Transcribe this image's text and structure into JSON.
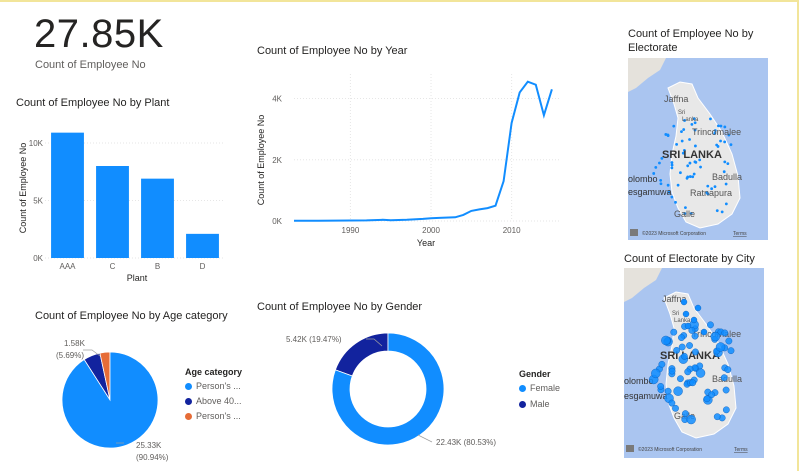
{
  "kpi": {
    "value": "27.85K",
    "label": "Count of Employee No"
  },
  "colors": {
    "primary": "#118dff",
    "dark_blue": "#12239e",
    "orange": "#e66c37",
    "map_water": "#aac5f0",
    "map_land": "#e8e8e8"
  },
  "chart_data": [
    {
      "type": "bar",
      "title": "Count of Employee No by Plant",
      "xlabel": "Plant",
      "ylabel": "Count of Employee No",
      "categories": [
        "AAA",
        "C",
        "B",
        "D"
      ],
      "values": [
        10900,
        8000,
        6900,
        2100
      ],
      "ylim": [
        0,
        12000
      ],
      "yticks": [
        0,
        5000,
        10000
      ],
      "ytick_labels": [
        "0K",
        "5K",
        "10K"
      ],
      "grid": true
    },
    {
      "type": "line",
      "title": "Count of Employee No by Year",
      "xlabel": "Year",
      "ylabel": "Count of Employee No",
      "x": [
        1983,
        1986,
        1990,
        1992,
        1994,
        1995,
        1997,
        1999,
        2000,
        2001,
        2003,
        2004,
        2005,
        2006,
        2007,
        2008,
        2009,
        2010,
        2011,
        2012,
        2013,
        2014,
        2015
      ],
      "y": [
        10,
        10,
        15,
        20,
        40,
        25,
        40,
        70,
        90,
        100,
        120,
        200,
        330,
        380,
        420,
        500,
        1300,
        3200,
        4200,
        4550,
        4450,
        3450,
        4300
      ],
      "xlim": [
        1983,
        2016
      ],
      "ylim": [
        0,
        4800
      ],
      "xticks": [
        1990,
        2000,
        2010
      ],
      "yticks": [
        0,
        2000,
        4000
      ],
      "ytick_labels": [
        "0K",
        "2K",
        "4K"
      ],
      "grid": true
    },
    {
      "type": "pie",
      "title": "Count of Employee No by Age category",
      "legend_title": "Age category",
      "legend_position": "right",
      "slices": [
        {
          "name": "Person's ...",
          "value": 25330,
          "label": "25.33K",
          "pct_label": "(90.94%)",
          "color": "#118dff"
        },
        {
          "name": "Above 40...",
          "value": 1580,
          "label": "1.58K",
          "pct_label": "(5.69%)",
          "color": "#12239e"
        },
        {
          "name": "Person's ...",
          "value": 940,
          "label": "",
          "pct_label": "",
          "color": "#e66c37"
        }
      ]
    },
    {
      "type": "pie",
      "title": "Count of Employee No by Gender",
      "legend_title": "Gender",
      "legend_position": "right",
      "donut": true,
      "slices": [
        {
          "name": "Female",
          "value": 22430,
          "label": "22.43K (80.53%)",
          "color": "#118dff"
        },
        {
          "name": "Male",
          "value": 5420,
          "label": "5.42K (19.47%)",
          "color": "#12239e"
        }
      ]
    }
  ],
  "maps": [
    {
      "title_line1": "Count of Employee No by",
      "title_line2": "Electorate",
      "labels": {
        "country": "SRI LANKA",
        "jaffna": "Jaffna",
        "sri": "Sri",
        "lanka": "Lanka",
        "trincomalee": "Trincomalee",
        "colombo": "olombo",
        "badulla": "Badulla",
        "ratnapura": "Ratnapura",
        "sgamuwa": "esgamuwa",
        "galle": "Galle"
      },
      "attribution": "©2023 Microsoft Corporation",
      "terms": "Terms"
    },
    {
      "title_line1": "Count of Electorate by City",
      "labels": {
        "country": "SRI LANKA",
        "jaffna": "Jaffna",
        "sri": "Sri",
        "lanka": "Lanka",
        "trincomalee": "Trincomalee",
        "colombo": "olombo",
        "badulla": "Badulla",
        "ratnapura": "",
        "sgamuwa": "esgamuwa",
        "galle": "Galle"
      },
      "attribution": "©2023 Microsoft Corporation",
      "terms": "Terms"
    }
  ]
}
